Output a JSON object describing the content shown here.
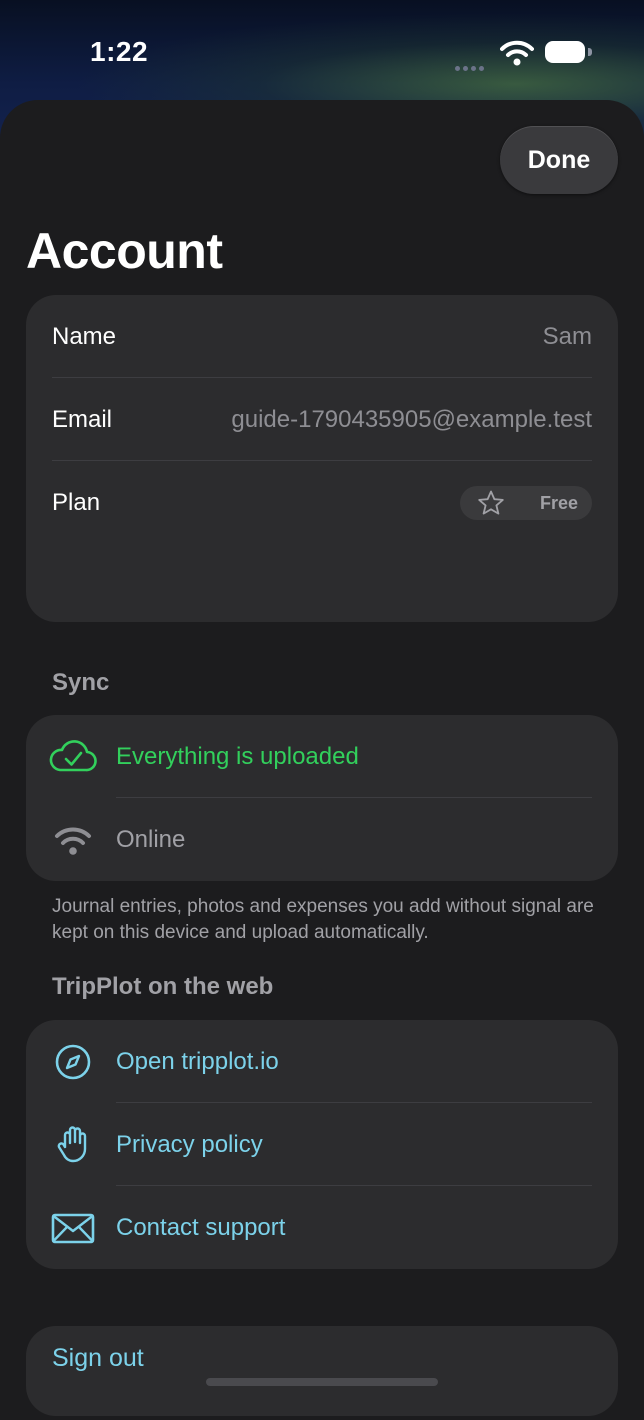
{
  "status_bar": {
    "time": "1:22"
  },
  "header": {
    "done_label": "Done",
    "title": "Account"
  },
  "account": {
    "name_label": "Name",
    "name_value": "Sam",
    "email_label": "Email",
    "email_value": "guide-1790435905@example.test",
    "plan_label": "Plan",
    "plan_value": "Free"
  },
  "sync": {
    "title": "Sync",
    "status_text": "Everything is uploaded",
    "connection_text": "Online",
    "footnote": "Journal entries, photos and expenses you add without signal are kept on this device and upload automatically."
  },
  "web": {
    "title": "TripPlot on the web",
    "items": [
      {
        "label": "Open tripplot.io",
        "icon": "compass-icon"
      },
      {
        "label": "Privacy policy",
        "icon": "hand-icon"
      },
      {
        "label": "Contact support",
        "icon": "envelope-icon"
      }
    ]
  },
  "footer": {
    "sign_out_label": "Sign out"
  },
  "colors": {
    "accent": "#7cd2ea",
    "success": "#32d05c",
    "card": "#2c2c2e",
    "sheet": "#1c1c1e"
  }
}
